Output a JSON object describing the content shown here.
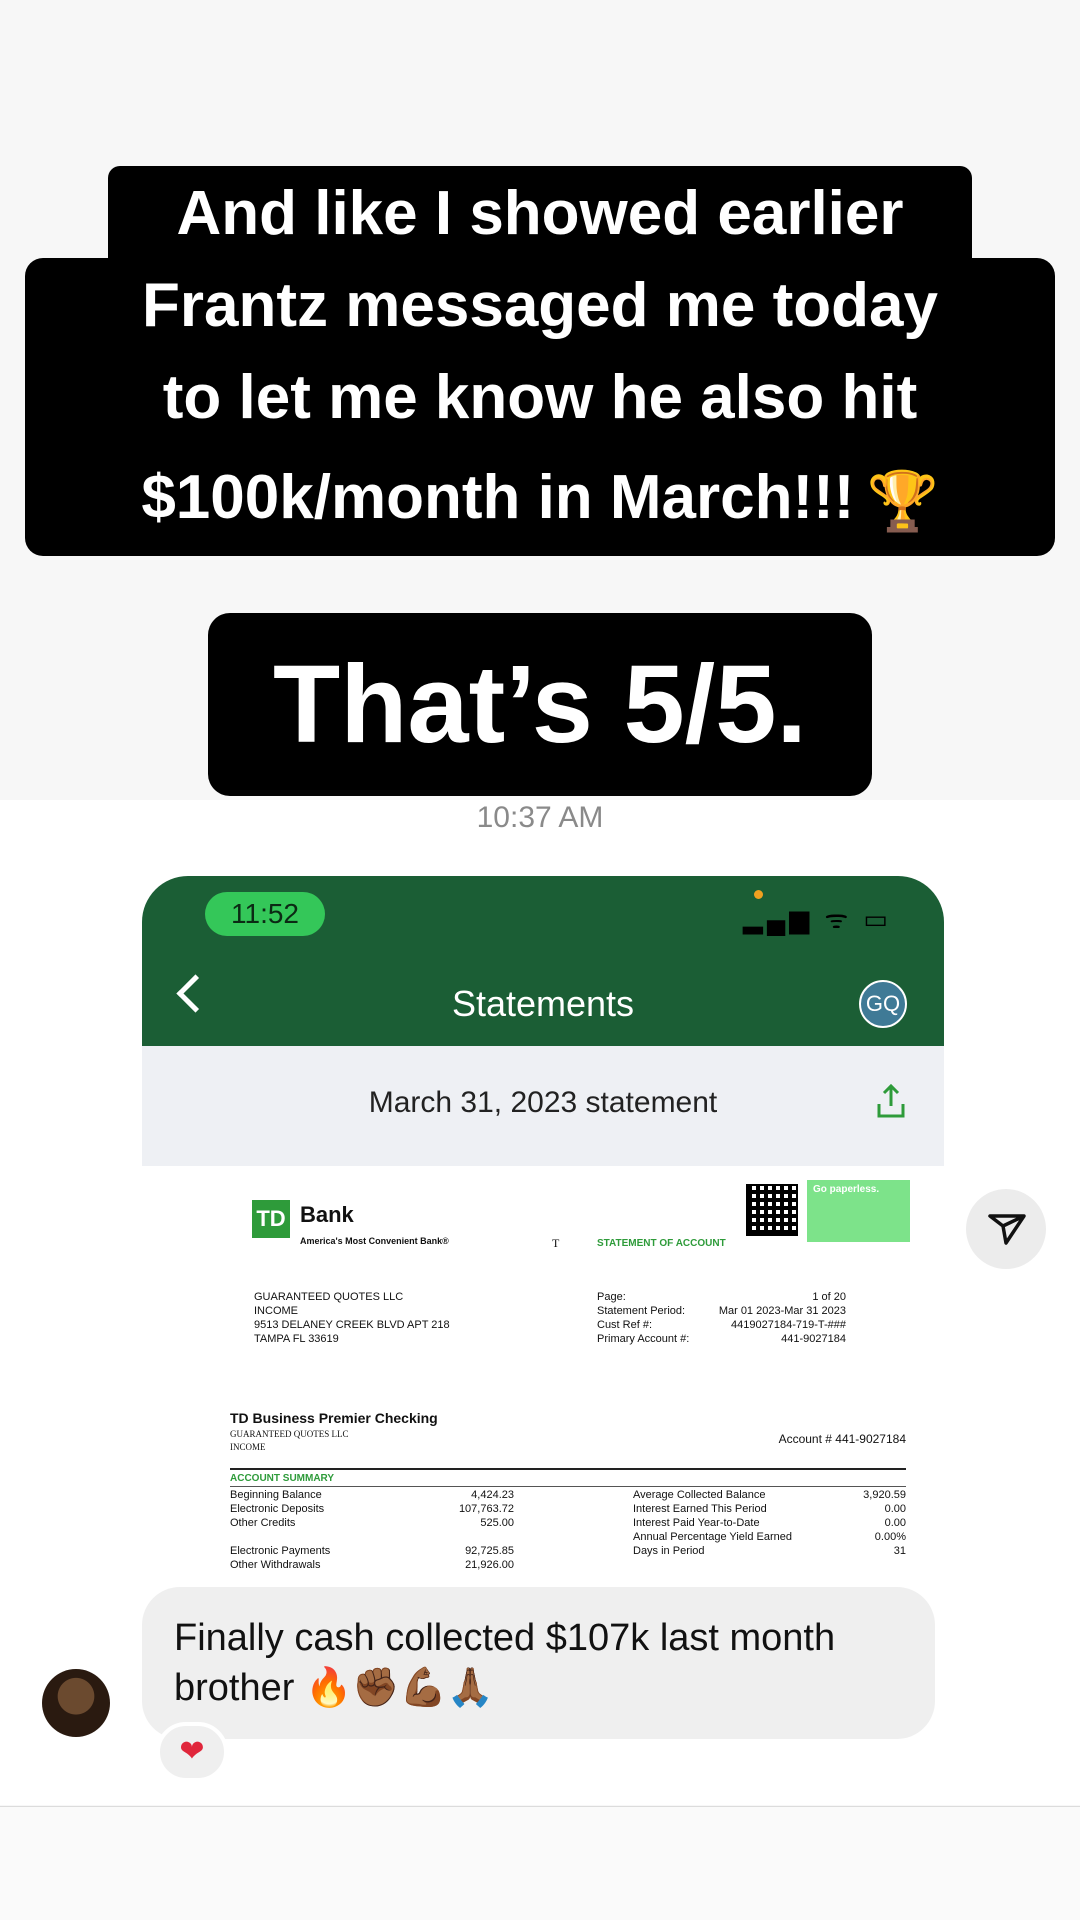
{
  "caption": {
    "line1": "And like I showed earlier",
    "line2": "Frantz messaged me today",
    "line3": "to let me know he also hit",
    "line4": "$100k/month in March!!!",
    "trophy": "🏆",
    "line5": "That’s 5/5."
  },
  "chat": {
    "timestamp": "10:37 AM",
    "message": "Finally cash collected $107k last month brother 🔥✊🏾💪🏾🙏🏾",
    "reaction": "❤"
  },
  "phone": {
    "status_time": "11:52",
    "status_icons": "▂▄▆ ᯤ ▭",
    "title": "Statements",
    "avatar_initials": "GQ",
    "statement_title": "March 31, 2023 statement"
  },
  "document": {
    "logo": "TD",
    "bank_name": "Bank",
    "tagline": "America's Most Convenient Bank®",
    "t_mark": "T",
    "statement_label": "STATEMENT OF ACCOUNT",
    "paperless": "Go paperless.",
    "address": [
      "GUARANTEED QUOTES LLC",
      "INCOME",
      "9513 DELANEY CREEK BLVD APT 218",
      "TAMPA FL  33619"
    ],
    "meta_labels": [
      "Page:",
      "Statement Period:",
      "Cust Ref #:",
      "Primary Account #:"
    ],
    "meta_values": [
      "1 of 20",
      "Mar 01 2023-Mar 31 2023",
      "4419027184-719-T-###",
      "441-9027184"
    ],
    "checking_title": "TD Business Premier Checking",
    "checking_sub": [
      "GUARANTEED QUOTES LLC",
      "INCOME"
    ],
    "account_number": "Account # 441-9027184",
    "account_summary": "ACCOUNT SUMMARY",
    "summary_labels": [
      "Beginning Balance",
      "Electronic Deposits",
      "Other Credits"
    ],
    "summary_values": [
      "4,424.23",
      "107,763.72",
      "525.00"
    ],
    "summary_labels2": [
      "Average Collected Balance",
      "Interest Earned This Period",
      "Interest Paid Year-to-Date",
      "Annual Percentage Yield Earned",
      "Days in Period"
    ],
    "summary_values2": [
      "3,920.59",
      "0.00",
      "0.00",
      "0.00%",
      "31"
    ],
    "payment_labels": [
      "Electronic Payments",
      "Other Withdrawals"
    ],
    "payment_values": [
      "92,725.85",
      "21,926.00"
    ]
  }
}
